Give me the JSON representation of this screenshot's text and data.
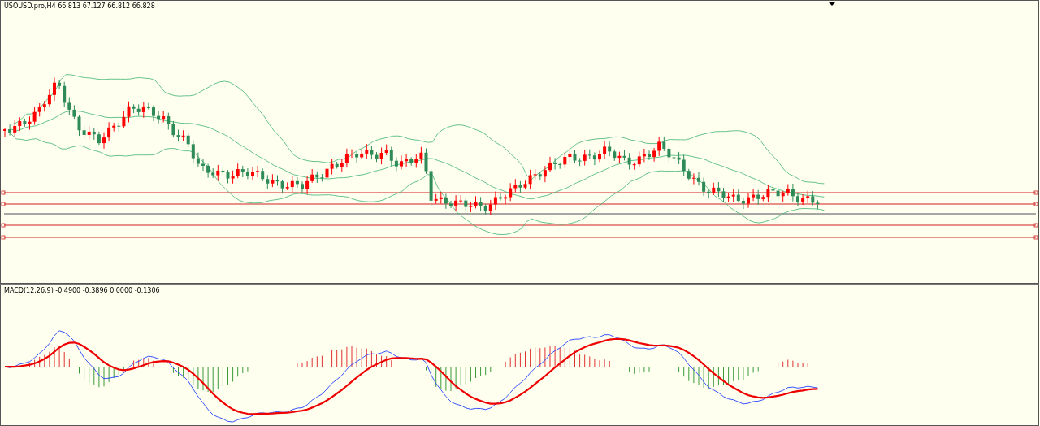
{
  "price_chart": {
    "symbol_info": "USOUSD.pro,H4  66.813 67.127 66.812 66.828"
  },
  "macd_panel": {
    "indicator_info": "MACD(12,26,9) -0.4900 -0.3896 0.0000 -0.1306"
  }
}
